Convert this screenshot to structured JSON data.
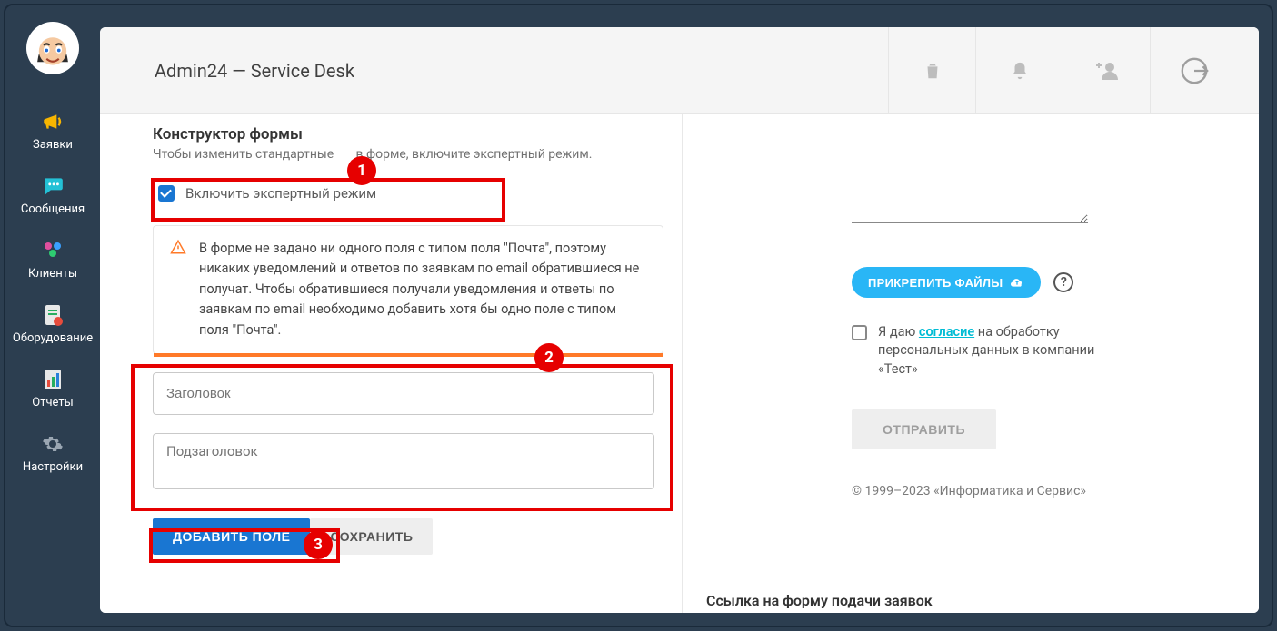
{
  "sidebar": {
    "items": [
      {
        "label": "Заявки"
      },
      {
        "label": "Сообщения"
      },
      {
        "label": "Клиенты"
      },
      {
        "label": "Оборудование"
      },
      {
        "label": "Отчеты"
      },
      {
        "label": "Настройки"
      }
    ]
  },
  "header": {
    "title": "Admin24 — Service Desk"
  },
  "constructor": {
    "title": "Конструктор формы",
    "subtitle": "Чтобы изменить стандартные       в форме, включите экспертный режим.",
    "expert_checkbox_label": "Включить экспертный режим",
    "warning_text": "В форме не задано ни одного поля с типом поля \"Почта\", поэтому никаких уведомлений и ответов по заявкам по email обратившиеся не получат. Чтобы обратившиеся получали уведомления и ответы по заявкам по email необходимо добавить хотя бы одно поле с типом поля \"Почта\".",
    "heading_placeholder": "Заголовок",
    "subheading_placeholder": "Подзаголовок",
    "add_field_btn": "ДОБАВИТЬ ПОЛЕ",
    "save_btn": "СОХРАНИТЬ"
  },
  "preview": {
    "attach_btn": "ПРИКРЕПИТЬ ФАЙЛЫ",
    "consent_prefix": "Я даю ",
    "consent_link": "согласие",
    "consent_suffix": " на обработку персональных данных в компании «Тест»",
    "submit_btn": "ОТПРАВИТЬ",
    "copyright": "© 1999–2023 «Информатика и Сервис»",
    "bottom_link_label": "Ссылка на форму подачи заявок"
  },
  "annotations": {
    "n1": "1",
    "n2": "2",
    "n3": "3"
  }
}
